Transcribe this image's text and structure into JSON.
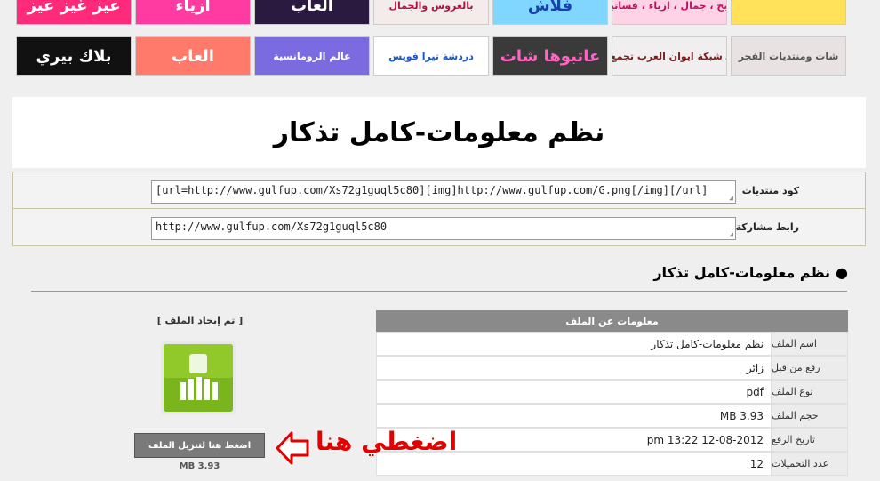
{
  "banners_row1": [
    {
      "text": "عيز غيز عيز",
      "bg": "#ff2a7a",
      "fg": "#ffffff"
    },
    {
      "text": "أزياء",
      "bg": "#ff3aa0",
      "fg": "#ffffff"
    },
    {
      "text": "العاب",
      "bg": "#2a1a40",
      "fg": "#ffffff"
    },
    {
      "text": "بالعروس والجمال",
      "bg": "#f3ecea",
      "fg": "#b01040"
    },
    {
      "text": "فلاش",
      "bg": "#7fd6ff",
      "fg": "#1a3fae"
    },
    {
      "text": "طبخ ، جمال ، ازياء ، فساتين",
      "bg": "#ffd3e6",
      "fg": "#c01060"
    },
    {
      "text": "",
      "bg": "#ffe25a",
      "fg": "#222222"
    }
  ],
  "banners_row2": [
    {
      "text": "بلاك بيري",
      "bg": "#111111",
      "fg": "#ffffff"
    },
    {
      "text": "العاب",
      "bg": "#ff7a6a",
      "fg": "#ffffff"
    },
    {
      "text": "عالم الرومانسية",
      "bg": "#7b6be0",
      "fg": "#ffffff"
    },
    {
      "text": "دردشة تيرا فويس",
      "bg": "#ffffff",
      "fg": "#1a56c8"
    },
    {
      "text": "عاتبوها شات",
      "bg": "#3a3a3a",
      "fg": "#ff66c4"
    },
    {
      "text": "انضم لـ شبكة ايوان العرب تجمع العرب",
      "bg": "#f0eeee",
      "fg": "#7a1e1e"
    },
    {
      "text": "شات ومنتديات الفجر",
      "bg": "#e8e2e2",
      "fg": "#555555"
    }
  ],
  "page_title": "نظم معلومات-كامل تذكار",
  "codes": {
    "forum_label": "كود منتديات",
    "forum_value": "[url=http://www.gulfup.com/Xs72g1guql5c80][img]http://www.gulfup.com/G.png[/img][/url]",
    "share_label": "رابط مشاركة",
    "share_value": "http://www.gulfup.com/Xs72g1guql5c80"
  },
  "section_heading": "نظم معلومات-كامل تذكار",
  "file_info": {
    "header": "معلومات عن الملف",
    "rows": [
      {
        "key": "اسم الملف",
        "value": "نظم معلومات-كامل تذكار"
      },
      {
        "key": "رفع من قبل",
        "value": "زائر"
      },
      {
        "key": "نوع الملف",
        "value": "pdf"
      },
      {
        "key": "حجم الملف",
        "value": "MB 3.93"
      },
      {
        "key": "تاريخ الرفع",
        "value": "pm 13:22 12-08-2012"
      },
      {
        "key": "عدد التحميلات",
        "value": "12"
      }
    ]
  },
  "download": {
    "status": "[ تم إيجاد الملف ]",
    "button_label": "اضغط هنا لتنزيل الملف",
    "size": "MB 3.93",
    "icon": "android-file-icon"
  },
  "annotation": {
    "text": "اضغطي هنا",
    "color": "#e30000"
  }
}
